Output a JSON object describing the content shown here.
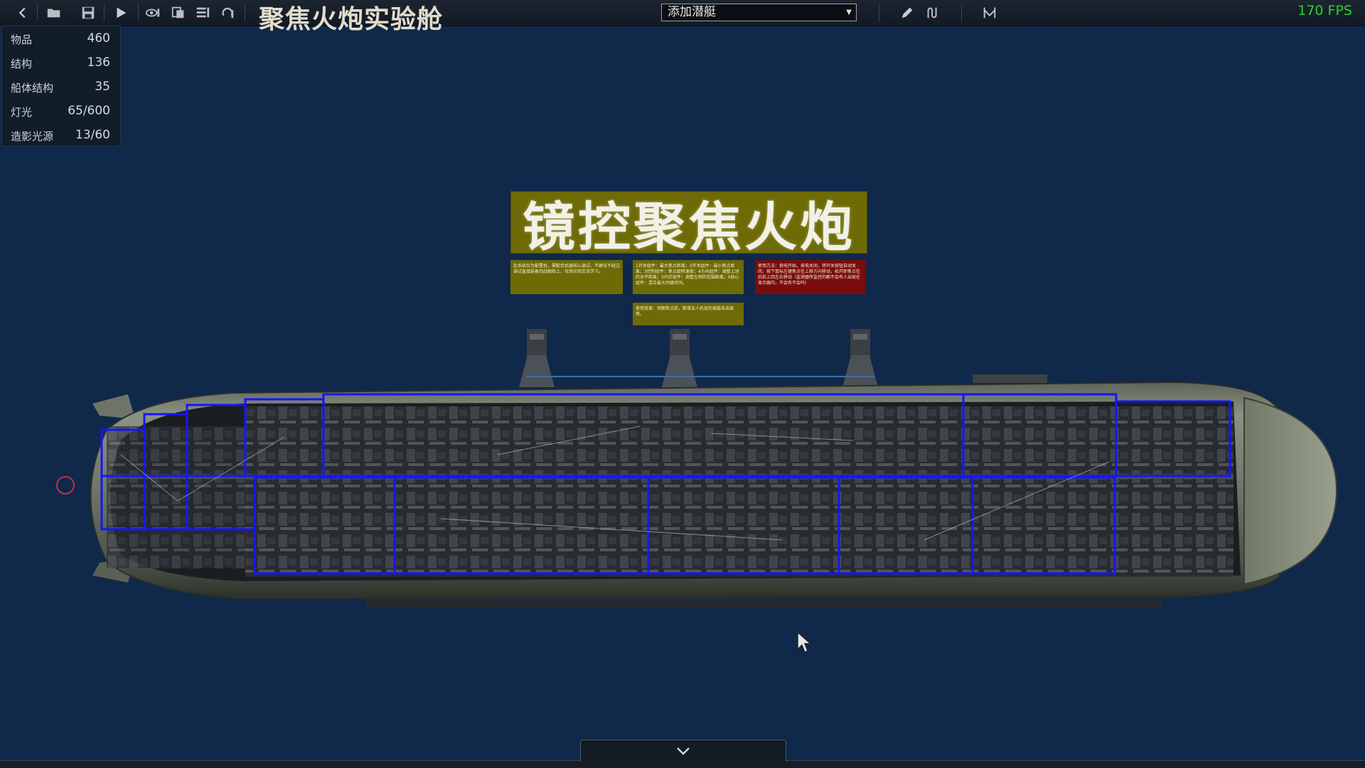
{
  "toolbar": {
    "title": "聚焦火炮实验舱",
    "add_sub_dropdown": "添加潜艇",
    "fps": "170 FPS"
  },
  "stats": [
    {
      "label": "物品",
      "value": "460"
    },
    {
      "label": "结构",
      "value": "136"
    },
    {
      "label": "船体结构",
      "value": "35"
    },
    {
      "label": "灯光",
      "value": "65/600"
    },
    {
      "label": "造影光源",
      "value": "13/60"
    }
  ],
  "sign": {
    "main_title": "镜控聚焦火炮",
    "notes": [
      "此系统仅为配置机，需配合武器核心调试，不建议不经过调试直接装备到战舰船上，仅供实验交流学习。",
      "1开关组件：最大焦点距离；2开关组件：最小焦点距离；3控制组件：焦点旋转速度；4方向组件：调整上述的水平距离；5内存组件：调整左侧的范围距离；6核心组件：混合最大同级时间。",
      "使用方法：按电开始，按电关闭，将开关按钮自动关闭，按下鼠标左键焦点往上移方向移动，松开即焦点往后前上回左右移动（监测器所监控的都不会有人出现在显示器内，不会有不会吗）",
      "使用效果：预期焦点前，新增无人机组先被敌击击毁等。"
    ]
  },
  "colors": {
    "background": "#102849",
    "sign_olive": "#6e6a05",
    "sign_red": "#7a0c0c",
    "room_outline": "#1010ff",
    "fps_green": "#2ed12e"
  }
}
